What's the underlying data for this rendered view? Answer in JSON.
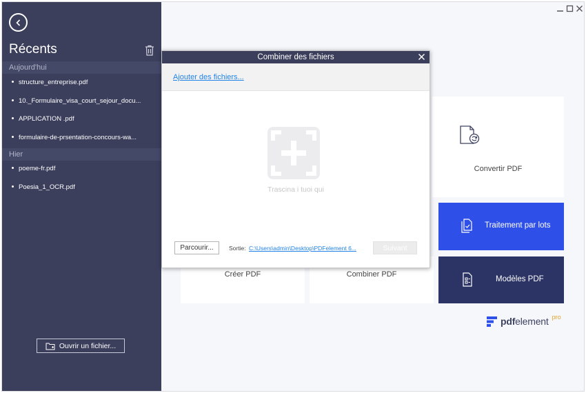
{
  "sidebar": {
    "title": "Récents",
    "groups": [
      {
        "label": "Aujourd'hui",
        "items": [
          "structure_entreprise.pdf",
          "10._Formulaire_visa_court_sejour_docu...",
          "APPLICATION .pdf",
          "formulaire-de-prsentation-concours-wa..."
        ]
      },
      {
        "label": "Hier",
        "items": [
          "poeme-fr.pdf",
          "Poesia_1_OCR.pdf"
        ]
      }
    ],
    "open_file_label": "Ouvrir un fichier..."
  },
  "main": {
    "cards": {
      "convert": "Convertir PDF",
      "batch": "Traitement par lots",
      "templates": "Modèles PDF",
      "create": "Créer PDF",
      "combine": "Combiner PDF"
    },
    "logo": {
      "bold": "pdf",
      "light": "element",
      "pro": "pro"
    }
  },
  "dialog": {
    "title": "Combiner des fichiers",
    "add_files": "Ajouter des fichiers...",
    "drop_text": "Trascina i tuoi qui",
    "browse_label": "Parcourir...",
    "output_label": "Sortie:",
    "output_path": "C:\\Users\\admin\\Desktop\\PDFelement 6...",
    "next_label": "Suivant"
  },
  "colors": {
    "sidebar_bg": "#3b3f5c",
    "accent_blue": "#2f50e8",
    "navy": "#2c3365",
    "link": "#2383e8",
    "logo_pro": "#e1a32b"
  }
}
